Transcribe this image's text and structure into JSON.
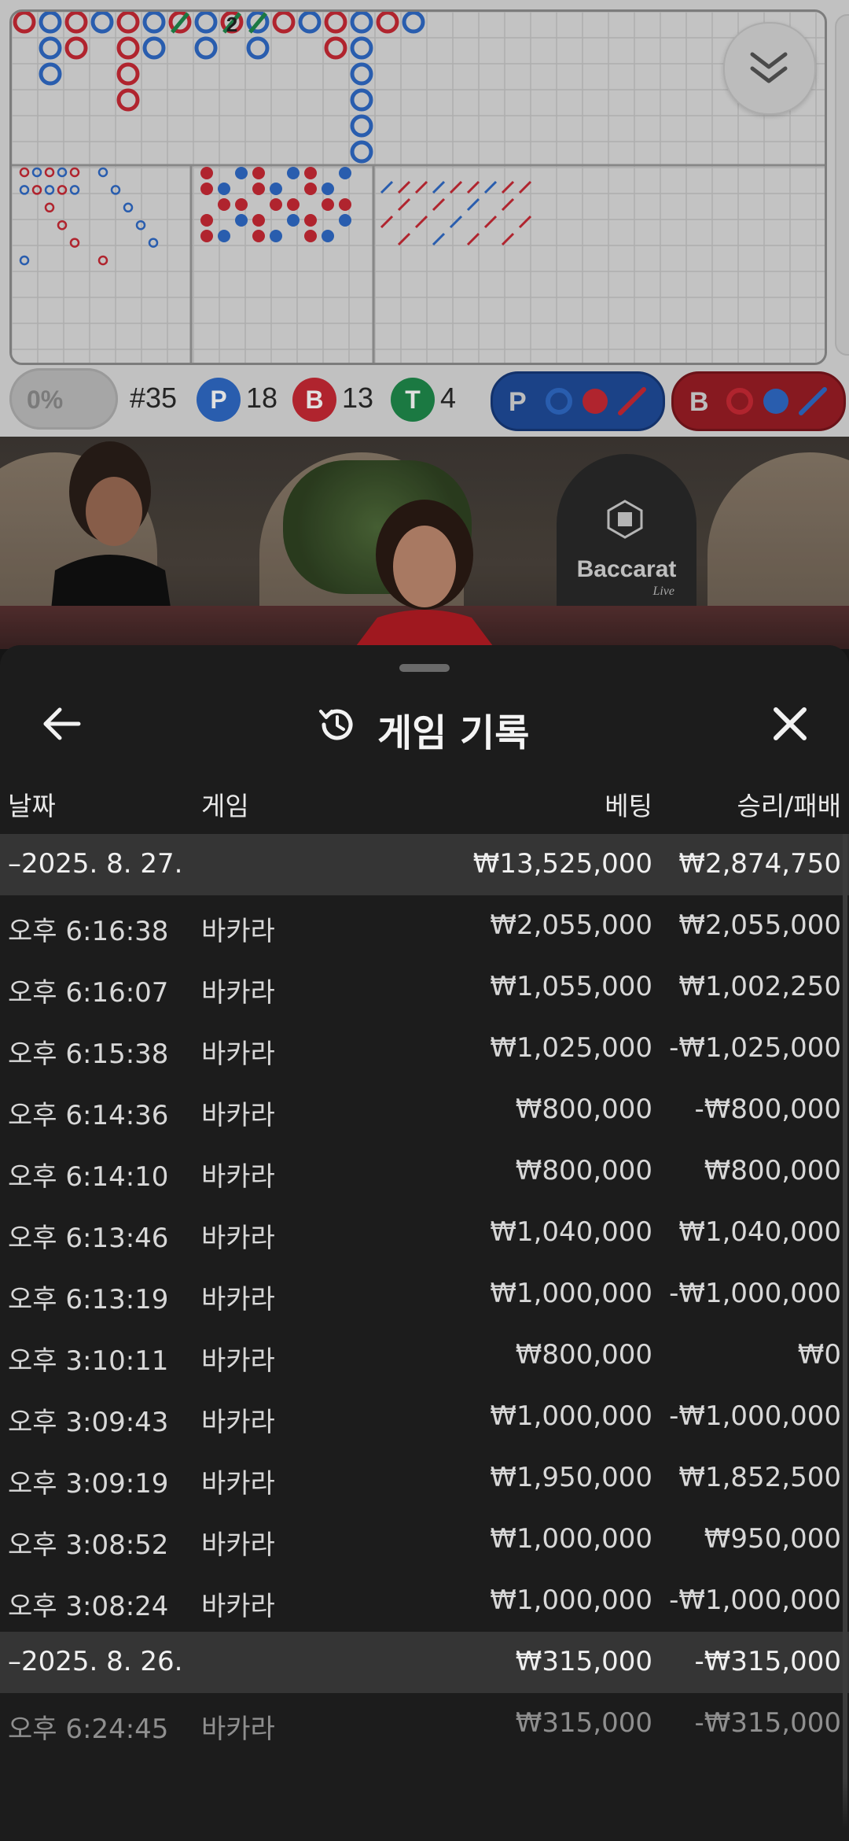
{
  "stats": {
    "percent_toggle": "0%",
    "round": "#35",
    "player_letter": "P",
    "player_count": "18",
    "banker_letter": "B",
    "banker_count": "13",
    "tie_letter": "T",
    "tie_count": "4",
    "player_predict_letter": "P",
    "banker_predict_letter": "B",
    "colors": {
      "player": "#2f6ac6",
      "banker": "#c92a35",
      "tie": "#1f8a4c"
    }
  },
  "bigroad_marker": "2",
  "video": {
    "sign_word": "Baccarat",
    "sign_sub": "Live"
  },
  "sheet": {
    "title": "게임 기록",
    "columns": {
      "time": "날짜",
      "game": "게임",
      "bet": "베팅",
      "win": "승리/패배"
    },
    "groups": [
      {
        "date": "–2025. 8. 27.",
        "bet_total": "₩13,525,000",
        "win_total": "₩2,874,750",
        "rows": [
          {
            "time": "오후 6:16:38",
            "game": "바카라",
            "bet": "₩2,055,000",
            "win": "₩2,055,000"
          },
          {
            "time": "오후 6:16:07",
            "game": "바카라",
            "bet": "₩1,055,000",
            "win": "₩1,002,250"
          },
          {
            "time": "오후 6:15:38",
            "game": "바카라",
            "bet": "₩1,025,000",
            "win": "-₩1,025,000"
          },
          {
            "time": "오후 6:14:36",
            "game": "바카라",
            "bet": "₩800,000",
            "win": "-₩800,000"
          },
          {
            "time": "오후 6:14:10",
            "game": "바카라",
            "bet": "₩800,000",
            "win": "₩800,000"
          },
          {
            "time": "오후 6:13:46",
            "game": "바카라",
            "bet": "₩1,040,000",
            "win": "₩1,040,000"
          },
          {
            "time": "오후 6:13:19",
            "game": "바카라",
            "bet": "₩1,000,000",
            "win": "-₩1,000,000"
          },
          {
            "time": "오후 3:10:11",
            "game": "바카라",
            "bet": "₩800,000",
            "win": "₩0"
          },
          {
            "time": "오후 3:09:43",
            "game": "바카라",
            "bet": "₩1,000,000",
            "win": "-₩1,000,000"
          },
          {
            "time": "오후 3:09:19",
            "game": "바카라",
            "bet": "₩1,950,000",
            "win": "₩1,852,500"
          },
          {
            "time": "오후 3:08:52",
            "game": "바카라",
            "bet": "₩1,000,000",
            "win": "₩950,000"
          },
          {
            "time": "오후 3:08:24",
            "game": "바카라",
            "bet": "₩1,000,000",
            "win": "-₩1,000,000"
          }
        ]
      },
      {
        "date": "–2025. 8. 26.",
        "bet_total": "₩315,000",
        "win_total": "-₩315,000",
        "rows": [
          {
            "time": "오후 6:24:45",
            "game": "바카라",
            "bet": "₩315,000",
            "win": "-₩315,000"
          }
        ]
      }
    ]
  }
}
